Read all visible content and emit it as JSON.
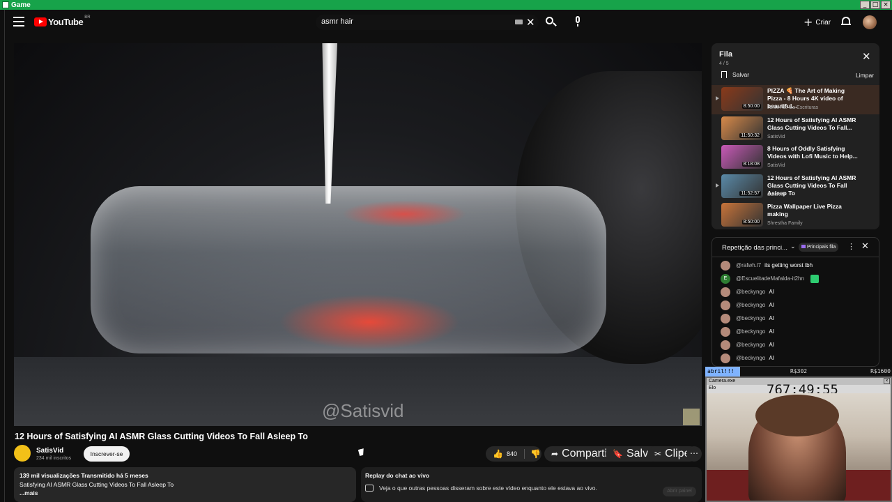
{
  "window": {
    "title": "Game",
    "controls": [
      "_",
      "□",
      "×"
    ]
  },
  "topbar": {
    "logo_text": "YouTube",
    "country_code": "BR",
    "search_value": "asmr hair",
    "create_label": "Criar"
  },
  "video": {
    "watermark": "@Satisvid",
    "title": "12 Hours of Satisfying AI ASMR Glass Cutting Videos To Fall Asleep To"
  },
  "channel": {
    "name": "SatisVid",
    "subscribers": "234 mil inscritos",
    "subscribe_label": "Inscrever-se"
  },
  "actions": {
    "likes": "840",
    "share_label": "Compartilhar",
    "save_label": "Salvar",
    "clip_label": "Clipe"
  },
  "description": {
    "stats": "139 mil visualizações  Transmitido há 5 meses",
    "text": "Satisfying AI ASMR Glass Cutting Videos To Fall Asleep To",
    "more": "...mais"
  },
  "chat_replay": {
    "title": "Replay do chat ao vivo",
    "text": "Veja o que outras pessoas disseram sobre este vídeo enquanto ele estava ao vivo.",
    "open_label": "Abrir painel"
  },
  "queue": {
    "title": "Fila",
    "count": "4 / 5",
    "save_label": "Salvar",
    "clear_label": "Limpar",
    "items": [
      {
        "title": "PIZZA 🍕 The Art of Making Pizza - 8 Hours 4K video of beautiful...",
        "channel": "Jardín de las Escrituras",
        "duration": "8:50:00",
        "thumb": "#8a3a1a"
      },
      {
        "title": "12 Hours of Satisfying AI ASMR Glass Cutting Videos To Fall...",
        "channel": "SatisVid",
        "duration": "11:50:32",
        "thumb": "#d88a4a"
      },
      {
        "title": "8 Hours of Oddly Satisfying Videos with Lofi Music to Help...",
        "channel": "SatisVid",
        "duration": "8:18:08",
        "thumb": "#c95ab8"
      },
      {
        "title": "12 Hours of Satisfying AI ASMR Glass Cutting Videos To Fall Asleep To",
        "channel": "SatisVid",
        "duration": "11:52:57",
        "thumb": "#5a8aa8"
      },
      {
        "title": "Pizza Wallpaper Live Pizza making",
        "channel": "Shrestha Family",
        "duration": "8:50:00",
        "thumb": "#c8743a"
      }
    ]
  },
  "chat": {
    "mode": "Repetição das princi...",
    "tag": "Principais fila",
    "messages": [
      {
        "user": "@rafwh.l7",
        "text": "its getting worst tbh",
        "avatar": ""
      },
      {
        "user": "@EscuelitadeMafalda-it2hn",
        "text": "",
        "avatar": "E"
      },
      {
        "user": "@beckyngo",
        "text": "AI",
        "avatar": ""
      },
      {
        "user": "@beckyngo",
        "text": "AI",
        "avatar": ""
      },
      {
        "user": "@beckyngo",
        "text": "AI",
        "avatar": ""
      },
      {
        "user": "@beckyngo",
        "text": "AI",
        "avatar": ""
      },
      {
        "user": "@beckyngo",
        "text": "AI",
        "avatar": ""
      },
      {
        "user": "@beckyngo",
        "text": "AI",
        "avatar": ""
      }
    ]
  },
  "overlay": {
    "goal": "abril!!!",
    "amount_mid": "R$302",
    "amount_right": "R$1600",
    "cam_title": "Camera.exe",
    "timer_label": "Elo",
    "timer": "767:49:55"
  }
}
